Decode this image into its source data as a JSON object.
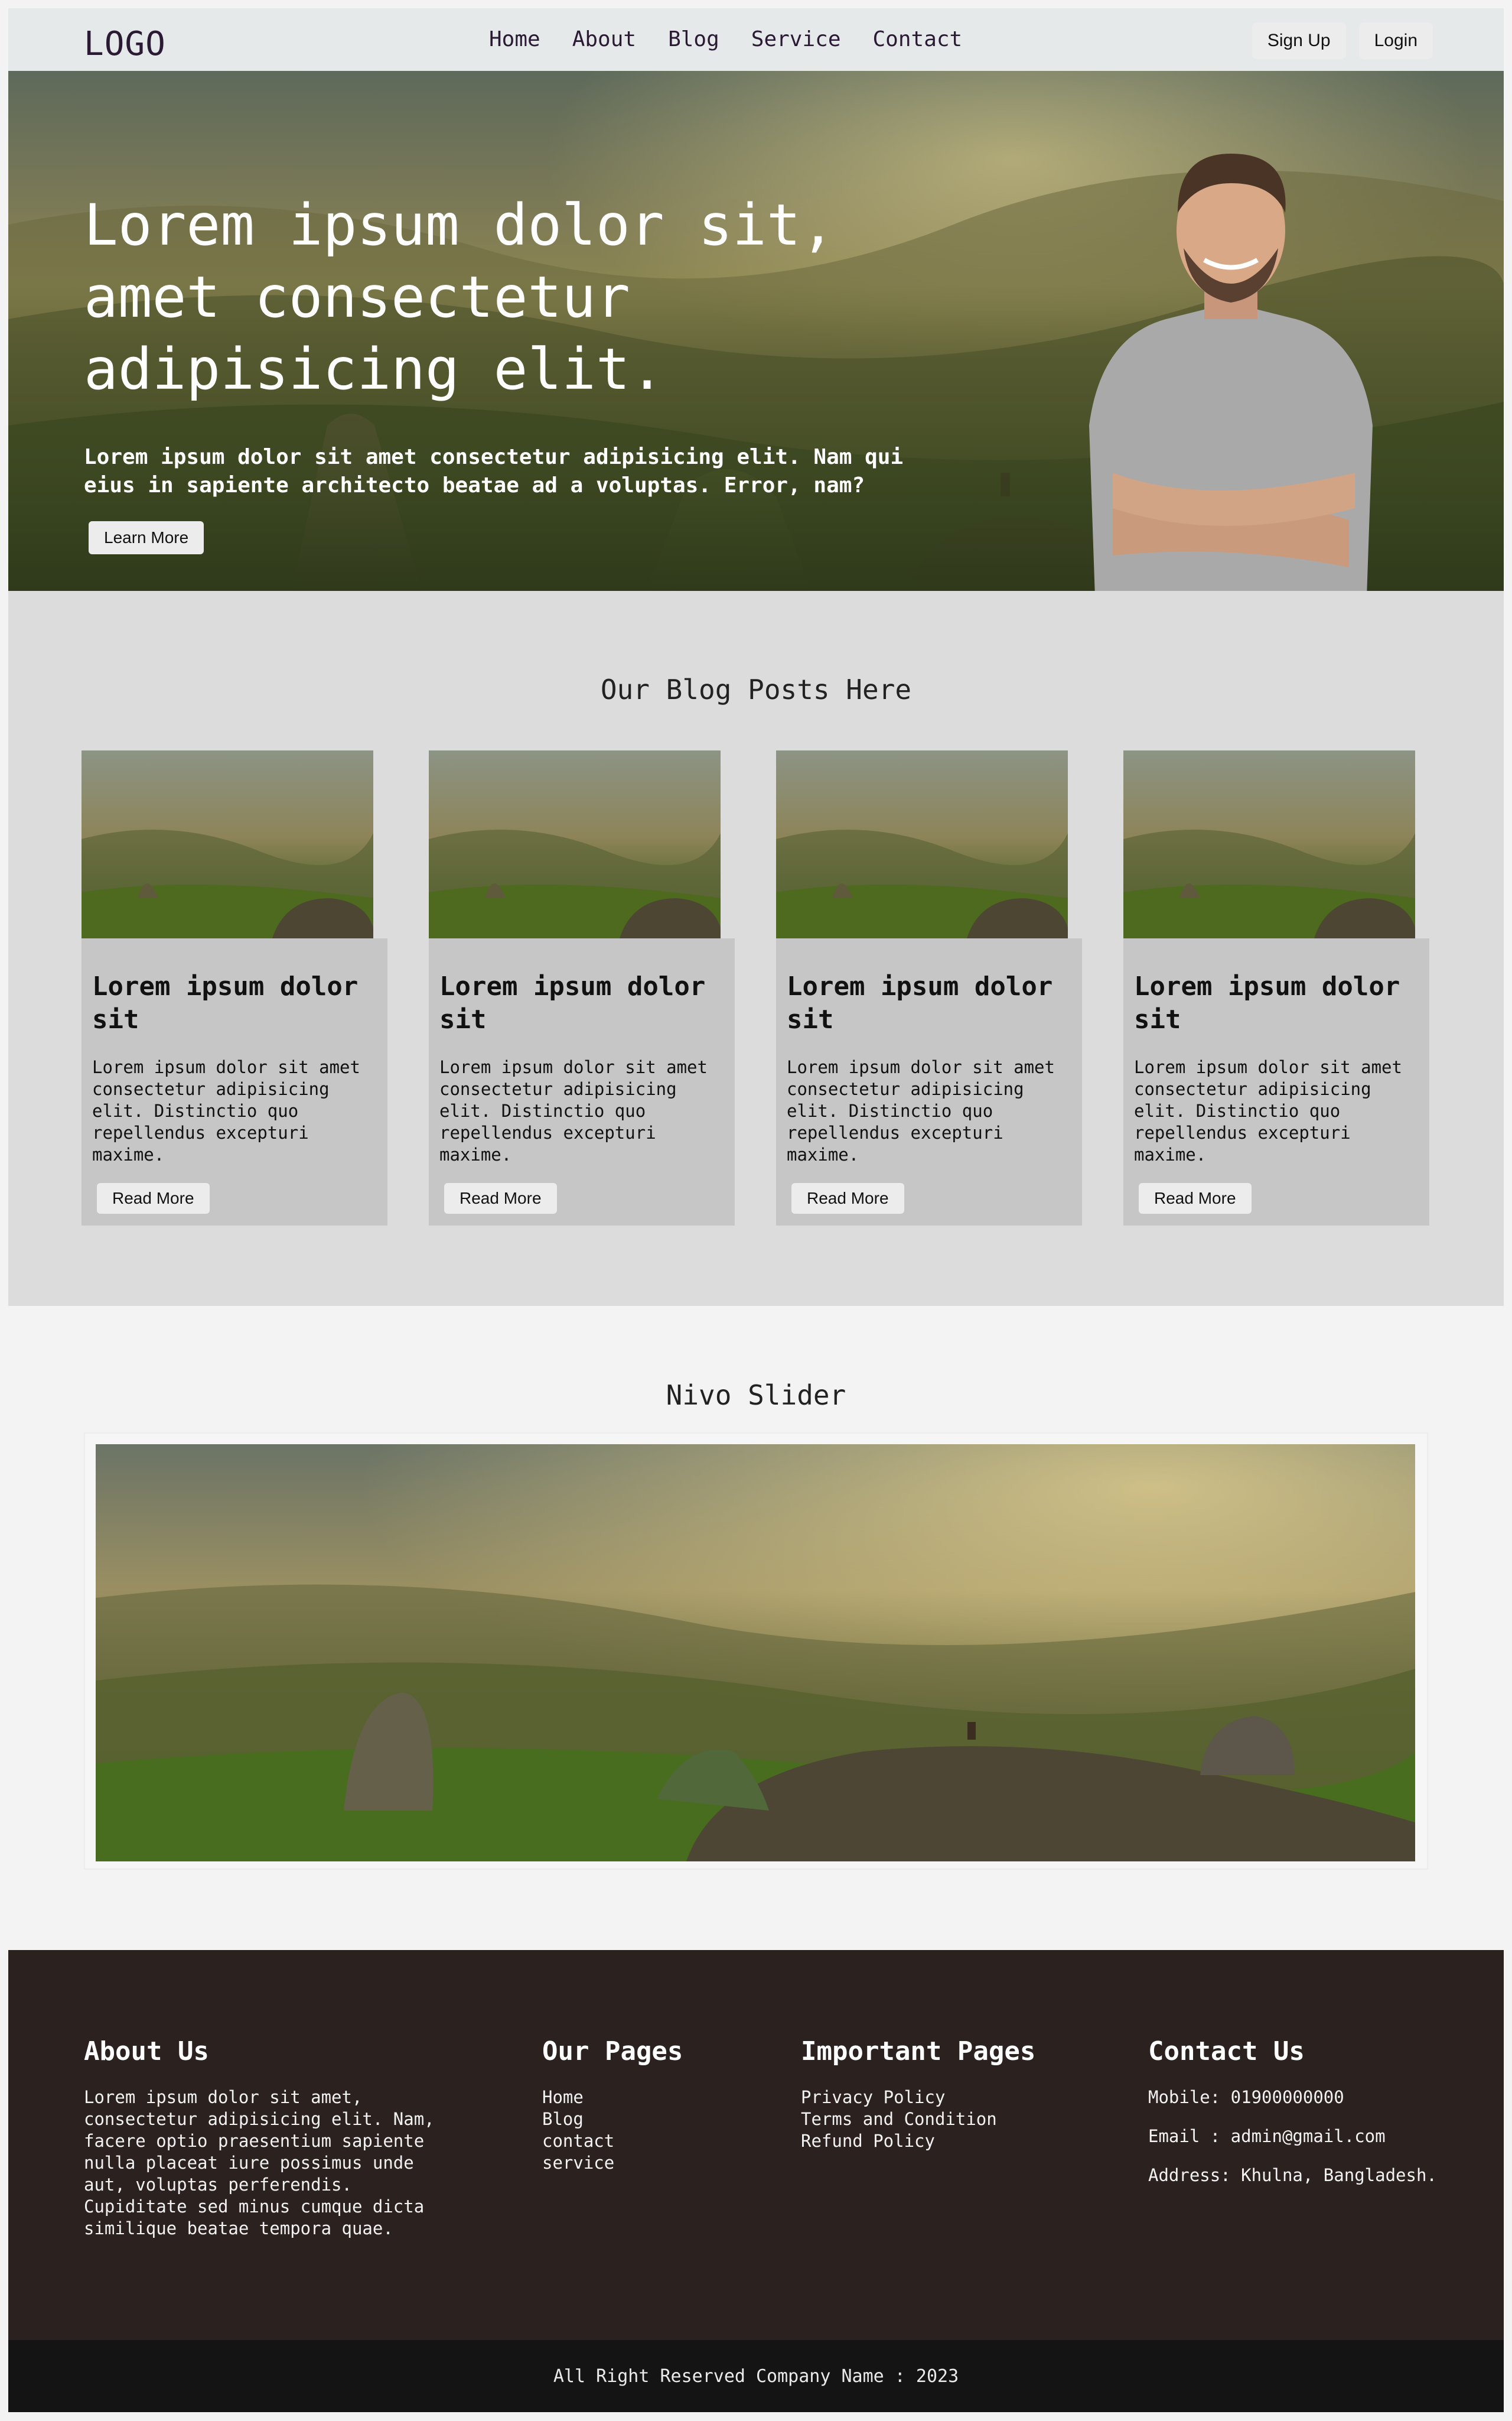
{
  "header": {
    "logo": "LOGO",
    "nav": [
      {
        "label": "Home"
      },
      {
        "label": "About"
      },
      {
        "label": "Blog"
      },
      {
        "label": "Service"
      },
      {
        "label": "Contact"
      }
    ],
    "signup_label": "Sign Up",
    "login_label": "Login"
  },
  "hero": {
    "title": "Lorem ipsum dolor sit, amet consectetur adipisicing elit.",
    "text": "Lorem ipsum dolor sit amet consectetur adipisicing elit. Nam qui eius in sapiente architecto beatae ad a voluptas. Error, nam?",
    "button_label": "Learn More"
  },
  "blog": {
    "heading": "Our Blog Posts Here",
    "posts": [
      {
        "title": "Lorem ipsum dolor sit",
        "text": "Lorem ipsum dolor sit amet consectetur adipisicing elit. Distinctio quo repellendus excepturi maxime.",
        "button": "Read More"
      },
      {
        "title": "Lorem ipsum dolor sit",
        "text": "Lorem ipsum dolor sit amet consectetur adipisicing elit. Distinctio quo repellendus excepturi maxime.",
        "button": "Read More"
      },
      {
        "title": "Lorem ipsum dolor sit",
        "text": "Lorem ipsum dolor sit amet consectetur adipisicing elit. Distinctio quo repellendus excepturi maxime.",
        "button": "Read More"
      },
      {
        "title": "Lorem ipsum dolor sit",
        "text": "Lorem ipsum dolor sit amet consectetur adipisicing elit. Distinctio quo repellendus excepturi maxime.",
        "button": "Read More"
      }
    ]
  },
  "slider": {
    "heading": "Nivo Slider"
  },
  "footer": {
    "about": {
      "heading": "About Us",
      "text": "Lorem ipsum dolor sit amet, consectetur adipisicing elit. Nam, facere optio praesentium sapiente nulla placeat iure possimus unde aut, voluptas perferendis. Cupiditate sed minus cumque dicta similique beatae tempora quae."
    },
    "pages": {
      "heading": "Our Pages",
      "items": [
        "Home",
        "Blog",
        "contact",
        "service"
      ]
    },
    "important": {
      "heading": "Important Pages",
      "items": [
        "Privacy Policy",
        "Terms and Condition",
        "Refund Policy"
      ]
    },
    "contact": {
      "heading": "Contact Us",
      "mobile": "Mobile: 01900000000",
      "email": "Email : admin@gmail.com",
      "address": "Address: Khulna, Bangladesh."
    },
    "copyright": "All Right Reserved Company Name : 2023"
  },
  "colors": {
    "footer_bg": "#2b2220",
    "bottom_bar": "#141414",
    "blog_bg": "#dcdcdc",
    "card_bg": "#c6c6c6",
    "nav_bg": "#e6e9ea"
  }
}
